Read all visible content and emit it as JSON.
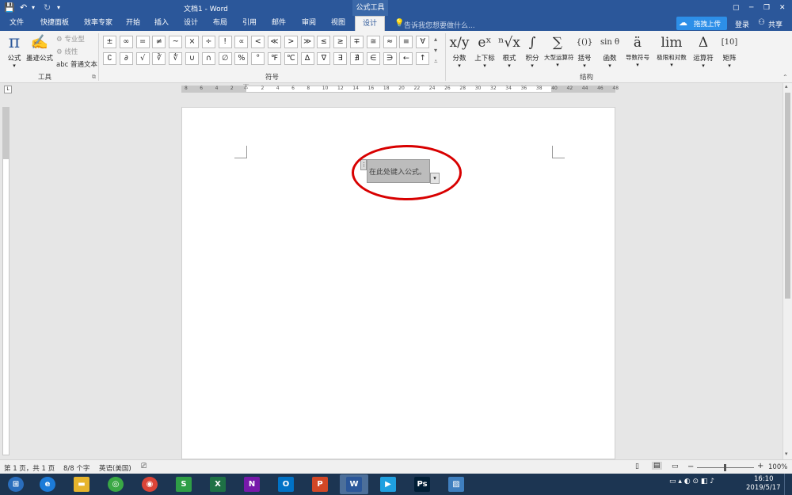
{
  "titlebar": {
    "doc_title": "文档1 - Word",
    "context_tab": "公式工具",
    "restore_icon": "▢",
    "min": "─",
    "max": "❐",
    "close": "✕"
  },
  "tabs": [
    "文件",
    "快捷面板",
    "效率专家",
    "开始",
    "插入",
    "设计",
    "布局",
    "引用",
    "邮件",
    "审阅",
    "视图",
    "设计"
  ],
  "active_tab_index": 11,
  "tell_me": "告诉我您想要做什么...",
  "upload_label": "拖拽上传",
  "login_label": "登录",
  "share_label": "共享",
  "tools_group": {
    "formula": "公式",
    "ink": "墨迹公式",
    "professional": "专业型",
    "linear": "线性",
    "normal_text": "普通文本",
    "label": "工具",
    "abc": "abc"
  },
  "symbols_group": {
    "label": "符号",
    "row1": [
      "±",
      "∞",
      "=",
      "≠",
      "~",
      "×",
      "÷",
      "!",
      "∝",
      "<",
      "≪",
      ">",
      "≫",
      "≤",
      "≥",
      "∓",
      "≅",
      "≈",
      "≡",
      "∀"
    ],
    "row2": [
      "∁",
      "∂",
      "√",
      "∛",
      "∜",
      "∪",
      "∩",
      "∅",
      "%",
      "°",
      "℉",
      "℃",
      "∆",
      "∇",
      "∃",
      "∄",
      "∈",
      "∋",
      "←",
      "↑"
    ]
  },
  "structures_group": {
    "label": "结构",
    "items": [
      {
        "glyph": "x/y",
        "label": "分数"
      },
      {
        "glyph": "eˣ",
        "label": "上下标"
      },
      {
        "glyph": "ⁿ√x",
        "label": "根式"
      },
      {
        "glyph": "∫",
        "label": "积分"
      },
      {
        "glyph": "∑",
        "label": "大型运算符"
      },
      {
        "glyph": "{()}",
        "label": "括号"
      },
      {
        "glyph": "sin θ",
        "label": "函数"
      },
      {
        "glyph": "ä",
        "label": "导数符号"
      },
      {
        "glyph": "lim",
        "label": "极限和对数"
      },
      {
        "glyph": "Δ",
        "label": "运算符"
      },
      {
        "glyph": "[10]",
        "label": "矩阵"
      }
    ]
  },
  "ruler_marks": [
    "8",
    "6",
    "4",
    "2",
    "",
    "2",
    "4",
    "6",
    "8",
    "10",
    "12",
    "14",
    "16",
    "18",
    "20",
    "22",
    "24",
    "26",
    "28",
    "30",
    "32",
    "34",
    "36",
    "38",
    "40",
    "42",
    "44",
    "46",
    "48"
  ],
  "equation_placeholder": "在此处键入公式。",
  "status": {
    "page": "第 1 页，共 1 页",
    "words": "8/8 个字",
    "language": "英语(美国)",
    "zoom": "100%",
    "minus": "−",
    "plus": "+"
  },
  "taskbar": {
    "time": "16:10",
    "date": "2019/5/17",
    "apps": [
      "start",
      "ie",
      "explorer",
      "360",
      "chrome",
      "wps",
      "excel",
      "onenote",
      "outlook",
      "powerpoint",
      "word",
      "media",
      "photoshop",
      "photos"
    ]
  },
  "colors": {
    "word_blue": "#2b579a",
    "annotation_red": "#d80000"
  }
}
